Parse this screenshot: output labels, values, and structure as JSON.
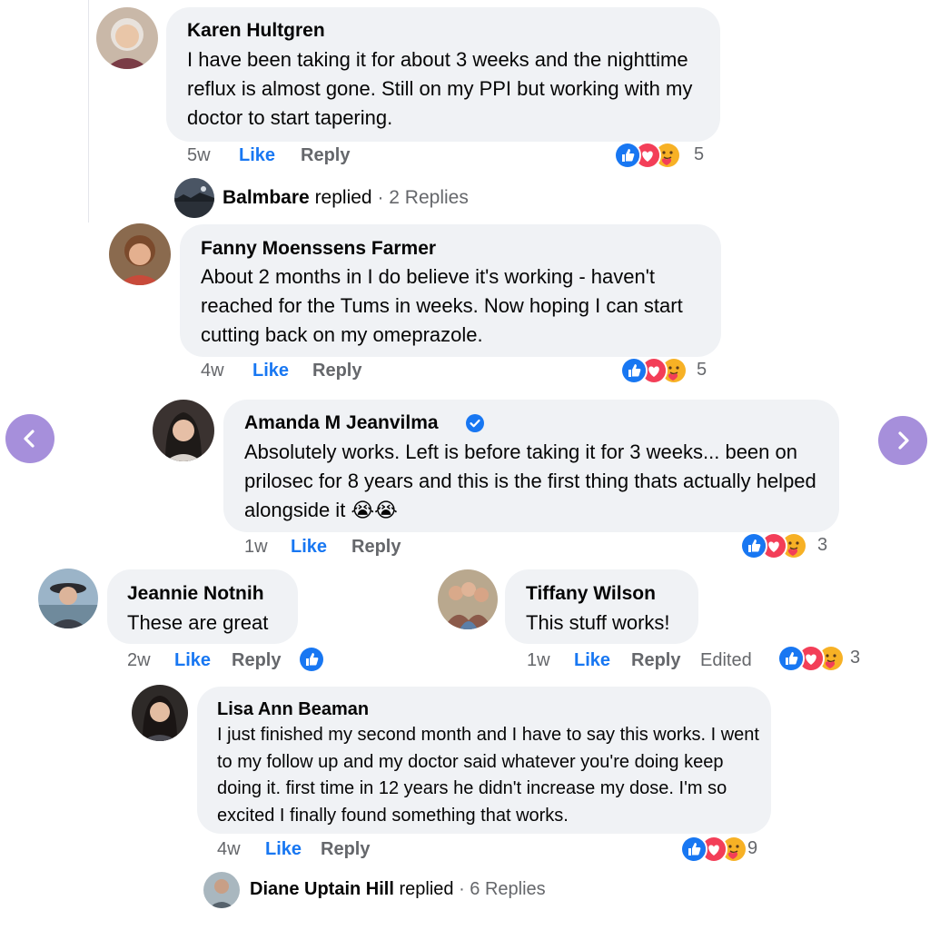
{
  "comments": [
    {
      "name": "Karen Hultgren",
      "text": "I have been taking it for about 3 weeks and the nighttime reflux is almost gone. Still on my PPI but working with my doctor to start tapering.",
      "age": "5w",
      "like": "Like",
      "reply": "Reply",
      "reaction_count": "5",
      "reactions": [
        "like-icon",
        "love-icon",
        "care-icon"
      ]
    },
    {
      "name": "Fanny Moenssens Farmer",
      "text": "About 2 months in I do believe it's working - haven't reached for the Tums in weeks. Now hoping I can start cutting back on my omeprazole.",
      "age": "4w",
      "like": "Like",
      "reply": "Reply",
      "reaction_count": "5",
      "reactions": [
        "like-icon",
        "love-icon",
        "care-icon"
      ]
    },
    {
      "name": "Amanda M Jeanvilma",
      "verified": true,
      "text": "Absolutely works. Left is before taking it for 3 weeks... been on prilosec for 8 years and this is the first thing thats actually helped alongside it",
      "emoji": "😭😭",
      "age": "1w",
      "like": "Like",
      "reply": "Reply",
      "reaction_count": "3",
      "reactions": [
        "like-icon",
        "love-icon",
        "care-icon"
      ]
    },
    {
      "name": "Jeannie Notnih",
      "text": "These are great",
      "age": "2w",
      "like": "Like",
      "reply": "Reply",
      "reactions": [
        "like-icon"
      ]
    },
    {
      "name": "Tiffany Wilson",
      "text": "This stuff works!",
      "age": "1w",
      "like": "Like",
      "reply": "Reply",
      "edited": "Edited",
      "reaction_count": "3",
      "reactions": [
        "like-icon",
        "love-icon",
        "care-icon"
      ]
    },
    {
      "name": "Lisa Ann Beaman",
      "text": "I just finished my second month and I have to say this works. I went to my follow up and my doctor said whatever you're doing keep doing it. first time in 12 years he didn't increase my dose. I'm so excited I finally found something that works.",
      "age": "4w",
      "like": "Like",
      "reply": "Reply",
      "reaction_count": "9",
      "reactions": [
        "like-icon",
        "love-icon",
        "care-icon"
      ]
    }
  ],
  "reply_summaries": [
    {
      "name": "Balmbare",
      "action": "replied",
      "count": "· 2 Replies"
    },
    {
      "name": "Diane Uptain Hill",
      "action": "replied",
      "count": "· 6 Replies"
    }
  ],
  "nav": {
    "prev_icon": "chevron-left-icon",
    "next_icon": "chevron-right-icon"
  },
  "colors": {
    "like_blue": "#1877f2",
    "bubble_gray": "#f0f2f5",
    "meta_gray": "#65676b",
    "nav_purple": "#a68fdb",
    "love_red": "#f33e58"
  }
}
